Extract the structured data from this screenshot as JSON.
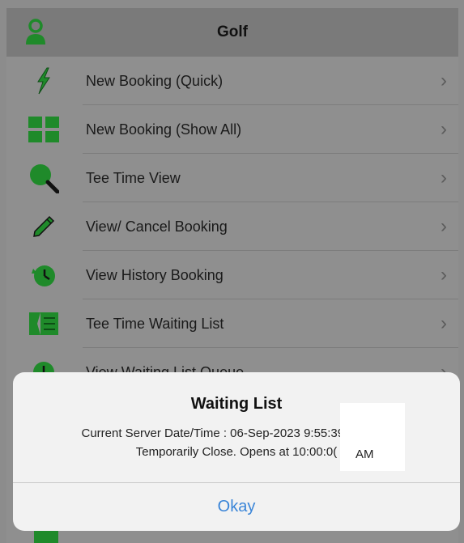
{
  "header": {
    "title": "Golf",
    "icon": "user-icon"
  },
  "menu": {
    "items": [
      {
        "label": "New Booking (Quick)",
        "icon": "lightning-icon"
      },
      {
        "label": "New Booking (Show All)",
        "icon": "grid-icon"
      },
      {
        "label": "Tee Time View",
        "icon": "search-icon"
      },
      {
        "label": "View/ Cancel Booking",
        "icon": "pencil-icon"
      },
      {
        "label": "View History Booking",
        "icon": "history-clock-icon"
      },
      {
        "label": "Tee Time Waiting List",
        "icon": "waiting-list-icon"
      },
      {
        "label": "View Waiting List Queue",
        "icon": "queue-clock-icon"
      }
    ],
    "chevron": "›"
  },
  "alert": {
    "title": "Waiting List",
    "message_line1": "Current Server Date/Time : 06-Sep-2023 9:55:39        Booking",
    "message_line2": "Temporarily Close. Opens at 10:00:0(",
    "overlay_text": "AM",
    "button_label": "Okay"
  },
  "colors": {
    "icon_green": "#1f8a2a",
    "button_blue": "#3a85d8"
  }
}
